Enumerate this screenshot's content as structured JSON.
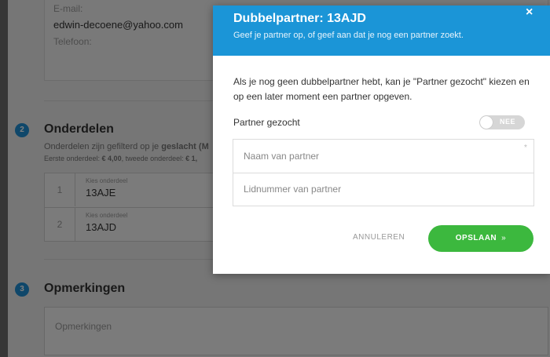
{
  "background_form": {
    "contact": {
      "email_label": "E-mail:",
      "email_value": "edwin-decoene@yahoo.com",
      "phone_label": "Telefoon:"
    },
    "onderdelen": {
      "step": "2",
      "title": "Onderdelen",
      "description_prefix": "Onderdelen zijn gefilterd op je ",
      "description_bold": "geslacht (M",
      "pricing_prefix": "Eerste onderdeel: ",
      "pricing_first": "€ 4,00",
      "pricing_middle": ", tweede onderdeel: ",
      "pricing_second": "€ 1,",
      "rows": [
        {
          "num": "1",
          "label": "Kies onderdeel",
          "code": "13AJE"
        },
        {
          "num": "2",
          "label": "Kies onderdeel",
          "code": "13AJD"
        }
      ]
    },
    "opmerkingen": {
      "step": "3",
      "title": "Opmerkingen",
      "placeholder": "Opmerkingen"
    }
  },
  "modal": {
    "title": "Dubbelpartner: 13AJD",
    "subtitle": "Geef je partner op, of geef aan dat je nog een partner zoekt.",
    "close_glyph": "×",
    "intro": "Als je nog geen dubbelpartner hebt, kan je \"Partner gezocht\" kiezen en op een later moment een partner opgeven.",
    "partner_gezocht_label": "Partner gezocht",
    "toggle_text": "NEE",
    "required_mark": "*",
    "name_placeholder": "Naam van partner",
    "member_placeholder": "Lidnummer van partner",
    "cancel_label": "ANNULEREN",
    "save_label": "OPSLAAN",
    "save_arrow": "»"
  },
  "colors": {
    "header_blue": "#1b95d7",
    "step_blue": "#1f8fd4",
    "save_green": "#3cb83e"
  }
}
